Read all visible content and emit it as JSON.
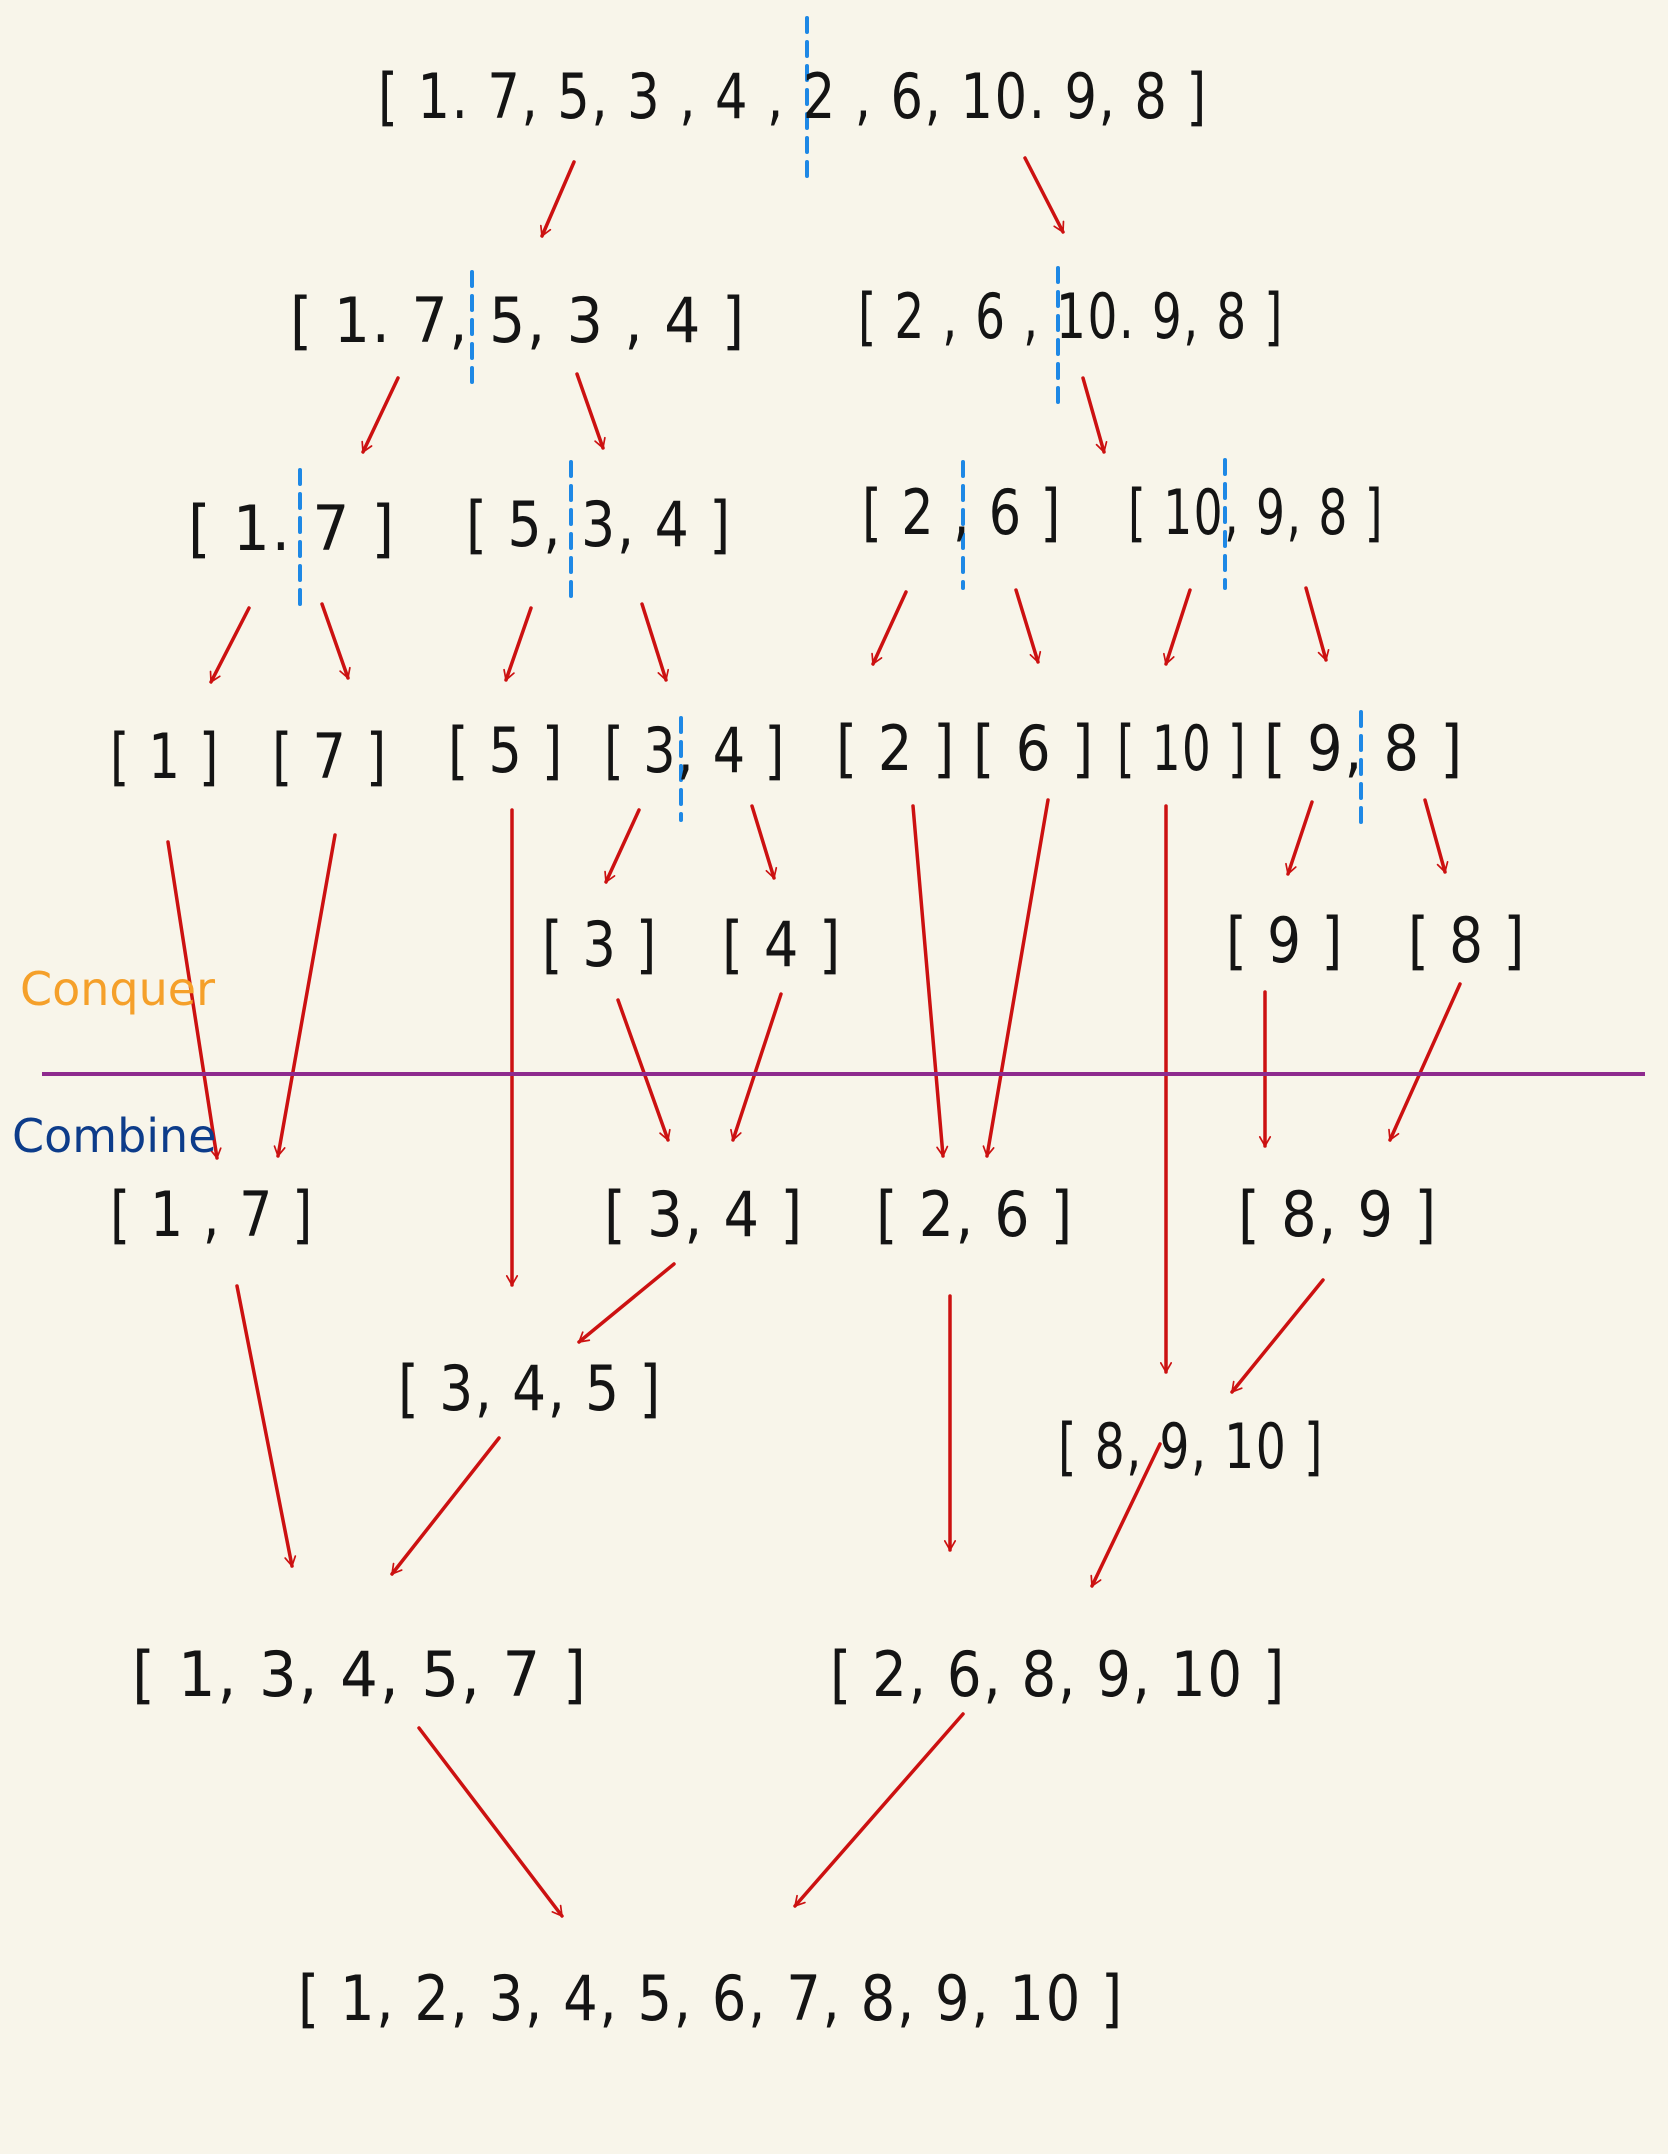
{
  "colors": {
    "background": "#f8f5ea",
    "text": "#141414",
    "arrow": "#cc1111",
    "split_line": "#1e88e5",
    "divider": "#8e2a8e",
    "conquer_label": "#f5a02a",
    "combine_label": "#0d3c8a"
  },
  "phases": {
    "conquer": "Conquer",
    "combine": "Combine"
  },
  "nodes": [
    {
      "id": "n0",
      "label": "[ 1. 7, 5, 3 , 4 , 2 , 6, 10. 9, 8 ]"
    },
    {
      "id": "n1",
      "label": "[ 1. 7, 5, 3 , 4 ]"
    },
    {
      "id": "n2",
      "label": "[ 2 , 6 , 10. 9, 8 ]"
    },
    {
      "id": "n3",
      "label": "[ 1. 7 ]"
    },
    {
      "id": "n4",
      "label": "[ 5, 3, 4 ]"
    },
    {
      "id": "n5",
      "label": "[ 2 , 6 ]"
    },
    {
      "id": "n6",
      "label": "[ 10, 9, 8 ]"
    },
    {
      "id": "n7",
      "label": "[ 1 ]"
    },
    {
      "id": "n8",
      "label": "[ 7 ]"
    },
    {
      "id": "n9",
      "label": "[ 5 ]"
    },
    {
      "id": "n10",
      "label": "[ 3, 4 ]"
    },
    {
      "id": "n11",
      "label": "[ 2 ]"
    },
    {
      "id": "n12",
      "label": "[ 6 ]"
    },
    {
      "id": "n13",
      "label": "[ 10 ]"
    },
    {
      "id": "n14",
      "label": "[ 9, 8 ]"
    },
    {
      "id": "n15",
      "label": "[ 3 ]"
    },
    {
      "id": "n16",
      "label": "[ 4 ]"
    },
    {
      "id": "n17",
      "label": "[ 9 ]"
    },
    {
      "id": "n18",
      "label": "[ 8 ]"
    },
    {
      "id": "n19",
      "label": "[ 1 , 7 ]"
    },
    {
      "id": "n20",
      "label": "[ 3, 4 ]"
    },
    {
      "id": "n21",
      "label": "[ 2, 6 ]"
    },
    {
      "id": "n22",
      "label": "[ 8, 9 ]"
    },
    {
      "id": "n23",
      "label": "[ 3, 4, 5 ]"
    },
    {
      "id": "n24",
      "label": "[ 8, 9, 10 ]"
    },
    {
      "id": "n25",
      "label": "[ 1, 3, 4, 5, 7 ]"
    },
    {
      "id": "n26",
      "label": "[ 2, 6, 8, 9, 10 ]"
    },
    {
      "id": "n27",
      "label": "[ 1, 2, 3, 4, 5, 6, 7, 8, 9, 10 ]"
    }
  ]
}
